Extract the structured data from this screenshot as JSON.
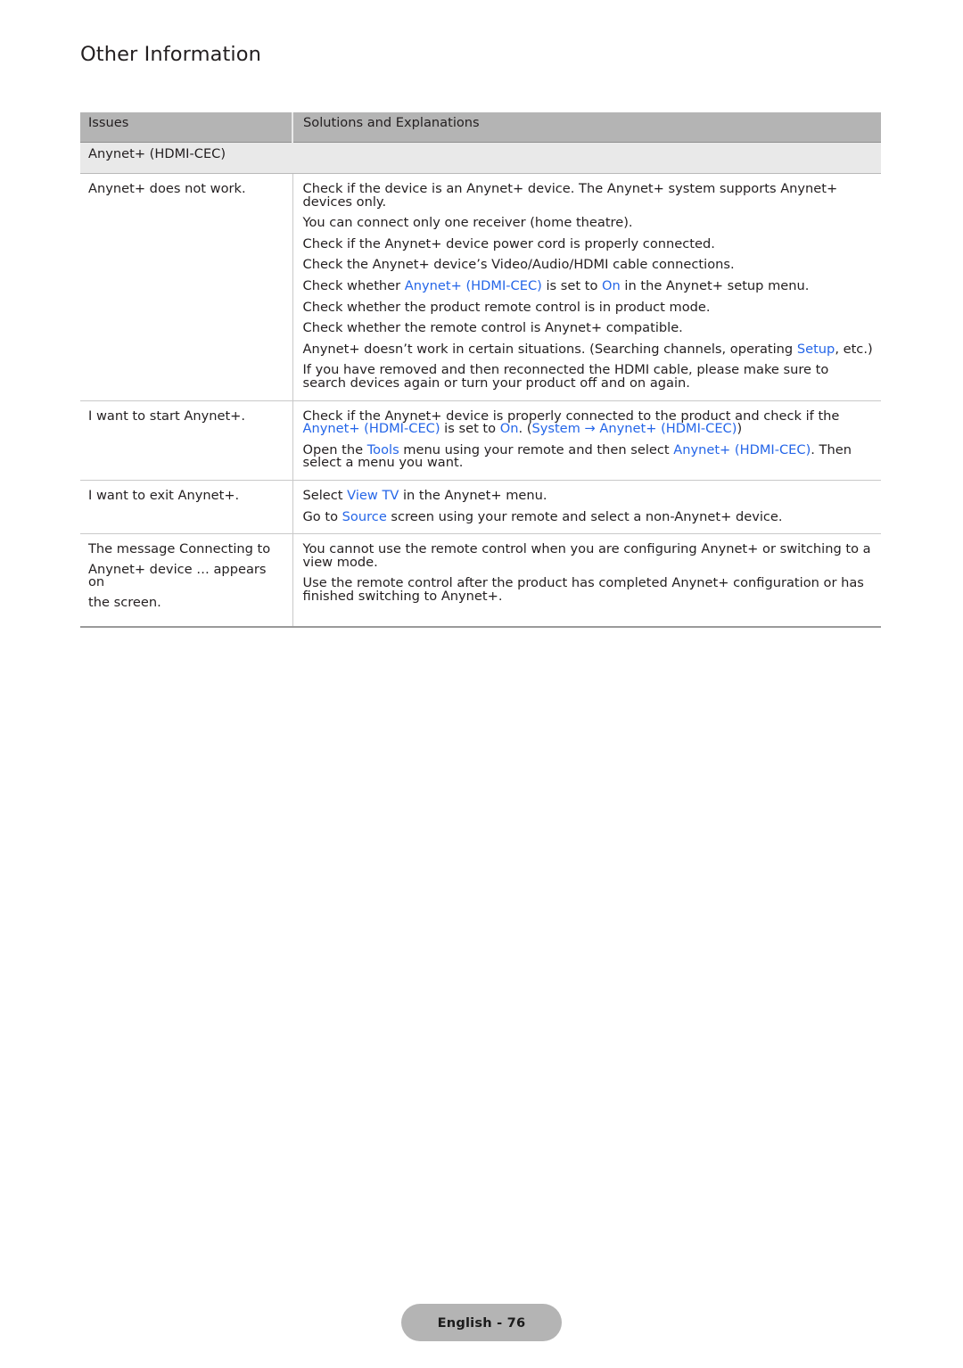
{
  "document": {
    "title": "Other Information",
    "footer_badge": "English - 76",
    "accent_color": "#2566e8",
    "header_bg": "#b4b4b4",
    "section_bg": "#e9e9e9"
  },
  "table": {
    "headers": {
      "issues": "Issues",
      "solutions": "Solutions and Explanations"
    },
    "section_label": "Anynet+ (HDMI-CEC)",
    "rows": [
      {
        "issue": [
          "Anynet+ does not work."
        ],
        "solutions": [
          {
            "parts": [
              {
                "t": "Check if the device is an Anynet+ device. The Anynet+ system supports Anynet+ devices only.",
                "link": false
              }
            ]
          },
          {
            "parts": [
              {
                "t": "You can connect only one receiver (home theatre).",
                "link": false
              }
            ]
          },
          {
            "parts": [
              {
                "t": "Check if the Anynet+ device power cord is properly connected.",
                "link": false
              }
            ]
          },
          {
            "parts": [
              {
                "t": "Check the Anynet+ device’s Video/Audio/HDMI cable connections.",
                "link": false
              }
            ]
          },
          {
            "parts": [
              {
                "t": "Check whether ",
                "link": false
              },
              {
                "t": "Anynet+ (HDMI-CEC)",
                "link": true
              },
              {
                "t": " is set to ",
                "link": false
              },
              {
                "t": "On",
                "link": true
              },
              {
                "t": " in the Anynet+ setup menu.",
                "link": false
              }
            ]
          },
          {
            "parts": [
              {
                "t": "Check whether the product remote control is in product mode.",
                "link": false
              }
            ]
          },
          {
            "parts": [
              {
                "t": "Check whether the remote control is Anynet+ compatible.",
                "link": false
              }
            ]
          },
          {
            "parts": [
              {
                "t": "Anynet+ doesn’t work in certain situations. (Searching channels, operating ",
                "link": false
              },
              {
                "t": "Setup",
                "link": true
              },
              {
                "t": ", etc.)",
                "link": false
              }
            ]
          },
          {
            "parts": [
              {
                "t": "If you have removed and then reconnected the HDMI cable, please make sure to search devices again or turn your product off and on again.",
                "link": false
              }
            ]
          }
        ]
      },
      {
        "issue": [
          "I want to start Anynet+."
        ],
        "solutions": [
          {
            "parts": [
              {
                "t": "Check if the Anynet+ device is properly connected to the product and check if the ",
                "link": false
              },
              {
                "t": "Anynet+ (HDMI-CEC)",
                "link": true
              },
              {
                "t": " is set to ",
                "link": false
              },
              {
                "t": "On",
                "link": true
              },
              {
                "t": ". (",
                "link": false
              },
              {
                "t": "System",
                "link": true
              },
              {
                "t": " → ",
                "link": true
              },
              {
                "t": "Anynet+ (HDMI-CEC)",
                "link": true
              },
              {
                "t": ")",
                "link": false
              }
            ]
          },
          {
            "parts": [
              {
                "t": "Open the ",
                "link": false
              },
              {
                "t": "Tools",
                "link": true
              },
              {
                "t": " menu using your remote and then select ",
                "link": false
              },
              {
                "t": "Anynet+ (HDMI-CEC)",
                "link": true
              },
              {
                "t": ". Then select a menu you want.",
                "link": false
              }
            ]
          }
        ]
      },
      {
        "issue": [
          "I want to exit Anynet+."
        ],
        "solutions": [
          {
            "parts": [
              {
                "t": "Select ",
                "link": false
              },
              {
                "t": "View TV",
                "link": true
              },
              {
                "t": " in the Anynet+ menu.",
                "link": false
              }
            ]
          },
          {
            "parts": [
              {
                "t": "Go to ",
                "link": false
              },
              {
                "t": "Source",
                "link": true
              },
              {
                "t": " screen using your remote and select a non-Anynet+ device.",
                "link": false
              }
            ]
          }
        ]
      },
      {
        "issue": [
          "The message Connecting to",
          "Anynet+ device … appears on",
          "the screen."
        ],
        "solutions": [
          {
            "parts": [
              {
                "t": "You cannot use the remote control when you are configuring Anynet+ or switching to a view mode.",
                "link": false
              }
            ]
          },
          {
            "parts": [
              {
                "t": "Use the remote control after the product has completed Anynet+ configuration or has finished switching to Anynet+.",
                "link": false
              }
            ]
          }
        ]
      }
    ]
  }
}
